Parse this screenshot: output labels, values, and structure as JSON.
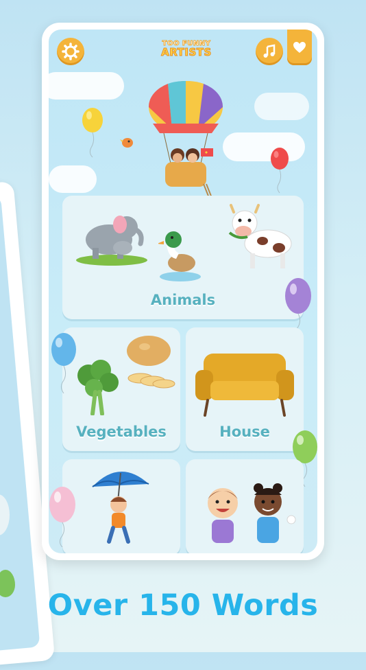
{
  "header": {
    "logo_line1": "TOO FUNNY",
    "logo_line2": "ARTISTS",
    "settings_icon": "gear-icon",
    "music_icon": "music-note-icon",
    "favorites_icon": "heart-icon"
  },
  "categories": [
    {
      "label": "Animals"
    },
    {
      "label": "Vegetables"
    },
    {
      "label": "House"
    },
    {
      "label": ""
    },
    {
      "label": ""
    }
  ],
  "caption": "Over 150 Words",
  "colors": {
    "accent": "#f4b43a",
    "label": "#57b1bf",
    "caption": "#27b4ea"
  }
}
